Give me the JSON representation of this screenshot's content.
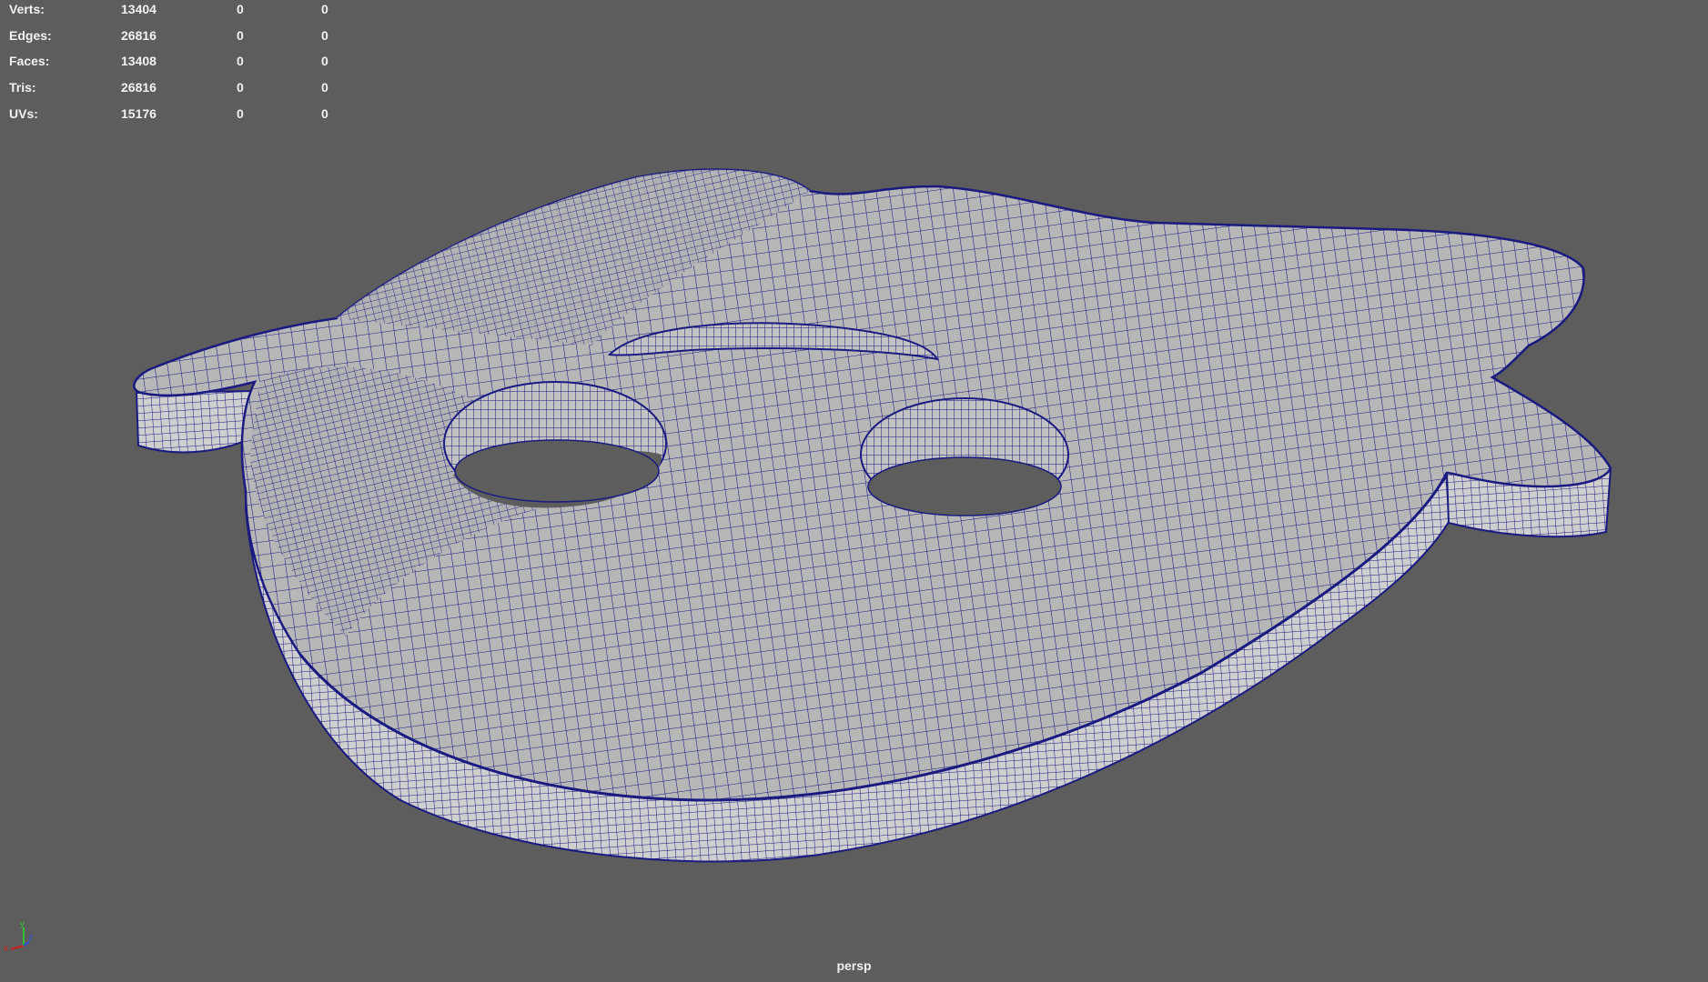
{
  "hud": {
    "rows": [
      {
        "label": "Verts:",
        "v1": "13404",
        "v2": "0",
        "v3": "0"
      },
      {
        "label": "Edges:",
        "v1": "26816",
        "v2": "0",
        "v3": "0"
      },
      {
        "label": "Faces:",
        "v1": "13408",
        "v2": "0",
        "v3": "0"
      },
      {
        "label": "Tris:",
        "v1": "26816",
        "v2": "0",
        "v3": "0"
      },
      {
        "label": "UVs:",
        "v1": "15176",
        "v2": "0",
        "v3": "0"
      }
    ]
  },
  "camera": {
    "name": "persp"
  },
  "axis": {
    "x": "x",
    "y": "y",
    "z": "z"
  },
  "colors": {
    "background": "#5d5d5d",
    "wire": "#1a1a80",
    "top_face": "#b7b7b7",
    "side_face": "#cfcfcf",
    "hole_inner": "#c2c2c2",
    "hud_text": "#f2f2f2",
    "axis_x": "#d02020",
    "axis_y": "#30c030",
    "axis_z": "#3050e0"
  },
  "icons": [
    "axis-gizmo-icon"
  ]
}
